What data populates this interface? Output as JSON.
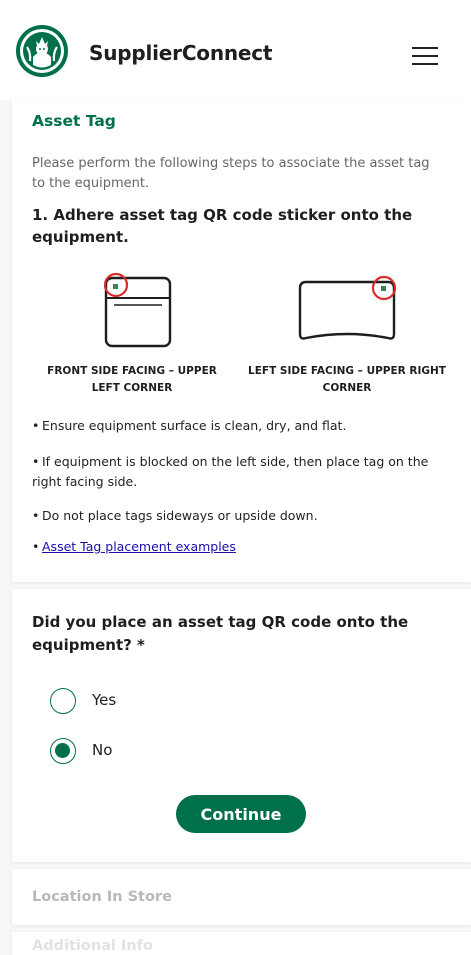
{
  "header": {
    "app_title": "SupplierConnect",
    "logo_icon": "starbucks-siren-logo",
    "menu_icon": "hamburger-menu-icon"
  },
  "asset_tag": {
    "title": "Asset Tag",
    "intro": "Please perform the following steps to associate the asset tag to the equipment.",
    "step1": "1. Adhere asset tag QR code sticker onto the equipment.",
    "diagrams": [
      {
        "label": "FRONT SIDE FACING – UPPER LEFT CORNER",
        "icon": "front-equipment-icon"
      },
      {
        "label": "LEFT SIDE FACING – UPPER RIGHT CORNER",
        "icon": "side-equipment-icon"
      }
    ],
    "bullets": [
      "Ensure equipment surface is clean, dry, and flat.",
      "If equipment is blocked on the left side, then place tag on the right facing side.",
      "Do not place tags sideways or upside down."
    ],
    "bullet_marker": "•",
    "link_text": "Asset Tag placement examples"
  },
  "question": {
    "text": "Did you place an asset tag QR code onto the equipment? *",
    "options": [
      {
        "label": "Yes",
        "selected": false
      },
      {
        "label": "No",
        "selected": true
      }
    ],
    "continue_label": "Continue"
  },
  "next_sections": [
    "Location In Store",
    "Additional Info"
  ],
  "colors": {
    "brand_green": "#00704a",
    "highlight_red": "#d62b2b",
    "link_blue": "#1a0dab"
  }
}
